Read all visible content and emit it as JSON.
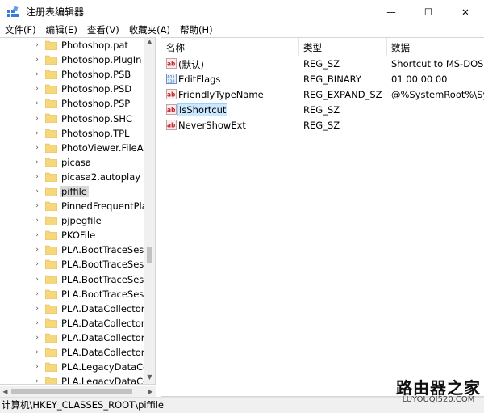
{
  "window": {
    "title": "注册表编辑器",
    "minimize": "—",
    "maximize": "☐",
    "close": "✕"
  },
  "menu": [
    "文件(F)",
    "编辑(E)",
    "查看(V)",
    "收藏夹(A)",
    "帮助(H)"
  ],
  "tree": {
    "items": [
      {
        "label": "Photoshop.pat"
      },
      {
        "label": "Photoshop.PlugIn"
      },
      {
        "label": "Photoshop.PSB"
      },
      {
        "label": "Photoshop.PSD"
      },
      {
        "label": "Photoshop.PSP"
      },
      {
        "label": "Photoshop.SHC"
      },
      {
        "label": "Photoshop.TPL"
      },
      {
        "label": "PhotoViewer.FileAss"
      },
      {
        "label": "picasa"
      },
      {
        "label": "picasa2.autoplay"
      },
      {
        "label": "piffile",
        "selected": true
      },
      {
        "label": "PinnedFrequentPlac"
      },
      {
        "label": "pjpegfile"
      },
      {
        "label": "PKOFile"
      },
      {
        "label": "PLA.BootTraceSessi"
      },
      {
        "label": "PLA.BootTraceSessi"
      },
      {
        "label": "PLA.BootTraceSessi"
      },
      {
        "label": "PLA.BootTraceSessi"
      },
      {
        "label": "PLA.DataCollectorSe"
      },
      {
        "label": "PLA.DataCollectorSe"
      },
      {
        "label": "PLA.DataCollectorSe"
      },
      {
        "label": "PLA.DataCollectorSe"
      },
      {
        "label": "PLA.LegacyDataColl"
      },
      {
        "label": "PLA.LegacyDataColl"
      }
    ]
  },
  "list": {
    "headers": {
      "name": "名称",
      "type": "类型",
      "data": "数据"
    },
    "rows": [
      {
        "icon": "string-value-icon",
        "name": "(默认)",
        "type": "REG_SZ",
        "data": "Shortcut to MS-DOS P"
      },
      {
        "icon": "binary-value-icon",
        "name": "EditFlags",
        "type": "REG_BINARY",
        "data": "01 00 00 00"
      },
      {
        "icon": "string-value-icon",
        "name": "FriendlyTypeName",
        "type": "REG_EXPAND_SZ",
        "data": "@%SystemRoot%\\Sys"
      },
      {
        "icon": "string-value-icon",
        "name": "IsShortcut",
        "type": "REG_SZ",
        "data": "",
        "selected": true
      },
      {
        "icon": "string-value-icon",
        "name": "NeverShowExt",
        "type": "REG_SZ",
        "data": ""
      }
    ]
  },
  "status": {
    "path": "计算机\\HKEY_CLASSES_ROOT\\piffile"
  },
  "watermark": {
    "cn": "路由器之家",
    "en": "LUYOUQI520.COM"
  },
  "colors": {
    "selection": "#cce8ff",
    "folder": "#f6d77b",
    "tree_selected": "#d9d9d9"
  }
}
